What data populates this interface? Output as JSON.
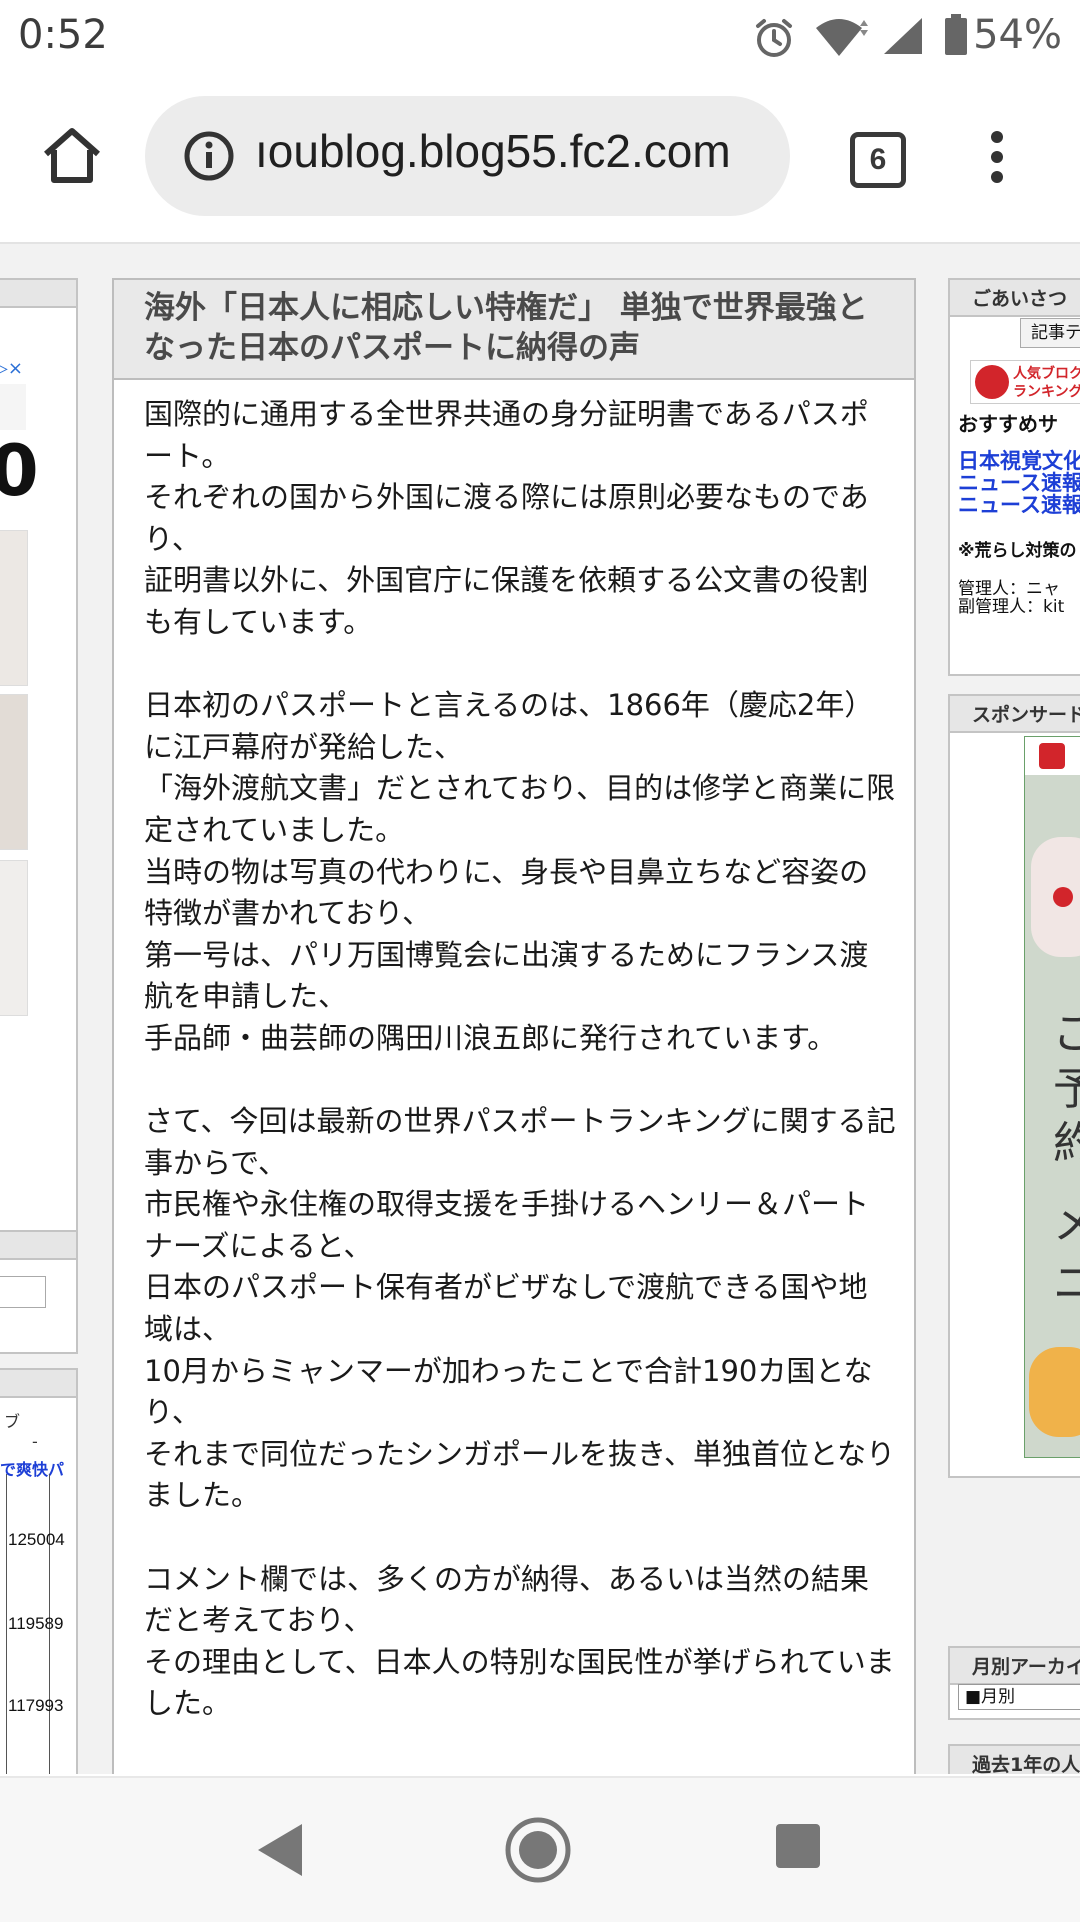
{
  "status_bar": {
    "time": "0:52",
    "battery": "54%"
  },
  "browser": {
    "url": "ıoublog.blog55.fc2.com",
    "tab_count": "6"
  },
  "article": {
    "title": "海外「日本人に相応しい特権だ」 単独で世界最強となった日本のパスポートに納得の声",
    "paragraphs": [
      "国際的に通用する全世界共通の身分証明書であるパスポート。\nそれぞれの国から外国に渡る際には原則必要なものであり、\n証明書以外に、外国官庁に保護を依頼する公文書の役割も有しています。",
      "日本初のパスポートと言えるのは、1866年（慶応2年）に江戸幕府が発給した、\n「海外渡航文書」だとされており、目的は修学と商業に限定されていました。\n当時の物は写真の代わりに、身長や目鼻立ちなど容姿の特徴が書かれており、\n第一号は、パリ万国博覧会に出演するためにフランス渡航を申請した、\n手品師・曲芸師の隅田川浪五郎に発行されています。",
      "さて、今回は最新の世界パスポートランキングに関する記事からで、\n市民権や永住権の取得支援を手掛けるヘンリー＆パートナーズによると、\n日本のパスポート保有者がビザなしで渡航できる国や地域は、\n10月からミャンマーが加わったことで合計190カ国となり、\nそれまで同位だったシンガポールを抜き、単独首位となりました。",
      "コメント欄では、多くの方が納得、あるいは当然の結果だと考えており、\nその理由として、日本人の特別な国民性が挙げられていました。"
    ]
  },
  "left_column": {
    "ad_close": "▷×",
    "ad_digit": "0",
    "table_header": "ブ",
    "table_dash": "-",
    "table_link": "で爽快パ",
    "table_values": [
      "125004",
      "119589",
      "117993"
    ]
  },
  "right_column": {
    "greeting_header": "ごあいさつ",
    "greeting_button": "記事テ",
    "ranking_banner_line1": "人気ブロク",
    "ranking_banner_line2": "ランキング",
    "recommend_label": "おすすめサ",
    "links": [
      "日本視覚文化",
      "ニュース速報",
      "ニュース速報"
    ],
    "notice": "※荒らし対策の",
    "admin_line1": "管理人：ニャ",
    "admin_line2": "副管理人：kit",
    "sponsor_header": "スポンサード",
    "archive_header": "月別アーカイ",
    "archive_select": "■月別",
    "past_year_header": "過去1年の人",
    "ad_text": [
      "ご",
      "予",
      "約",
      "メ",
      "ニ"
    ]
  },
  "colors": {
    "accent_link": "#1d3fd6",
    "panel_header": "#e6e6e6",
    "ad_red": "#d2252b"
  },
  "icons": [
    "home-icon",
    "info-icon",
    "menu-dots-icon",
    "alarm-icon",
    "wifi-icon",
    "signal-icon",
    "battery-icon",
    "back-icon",
    "home-nav-icon",
    "recents-icon"
  ]
}
